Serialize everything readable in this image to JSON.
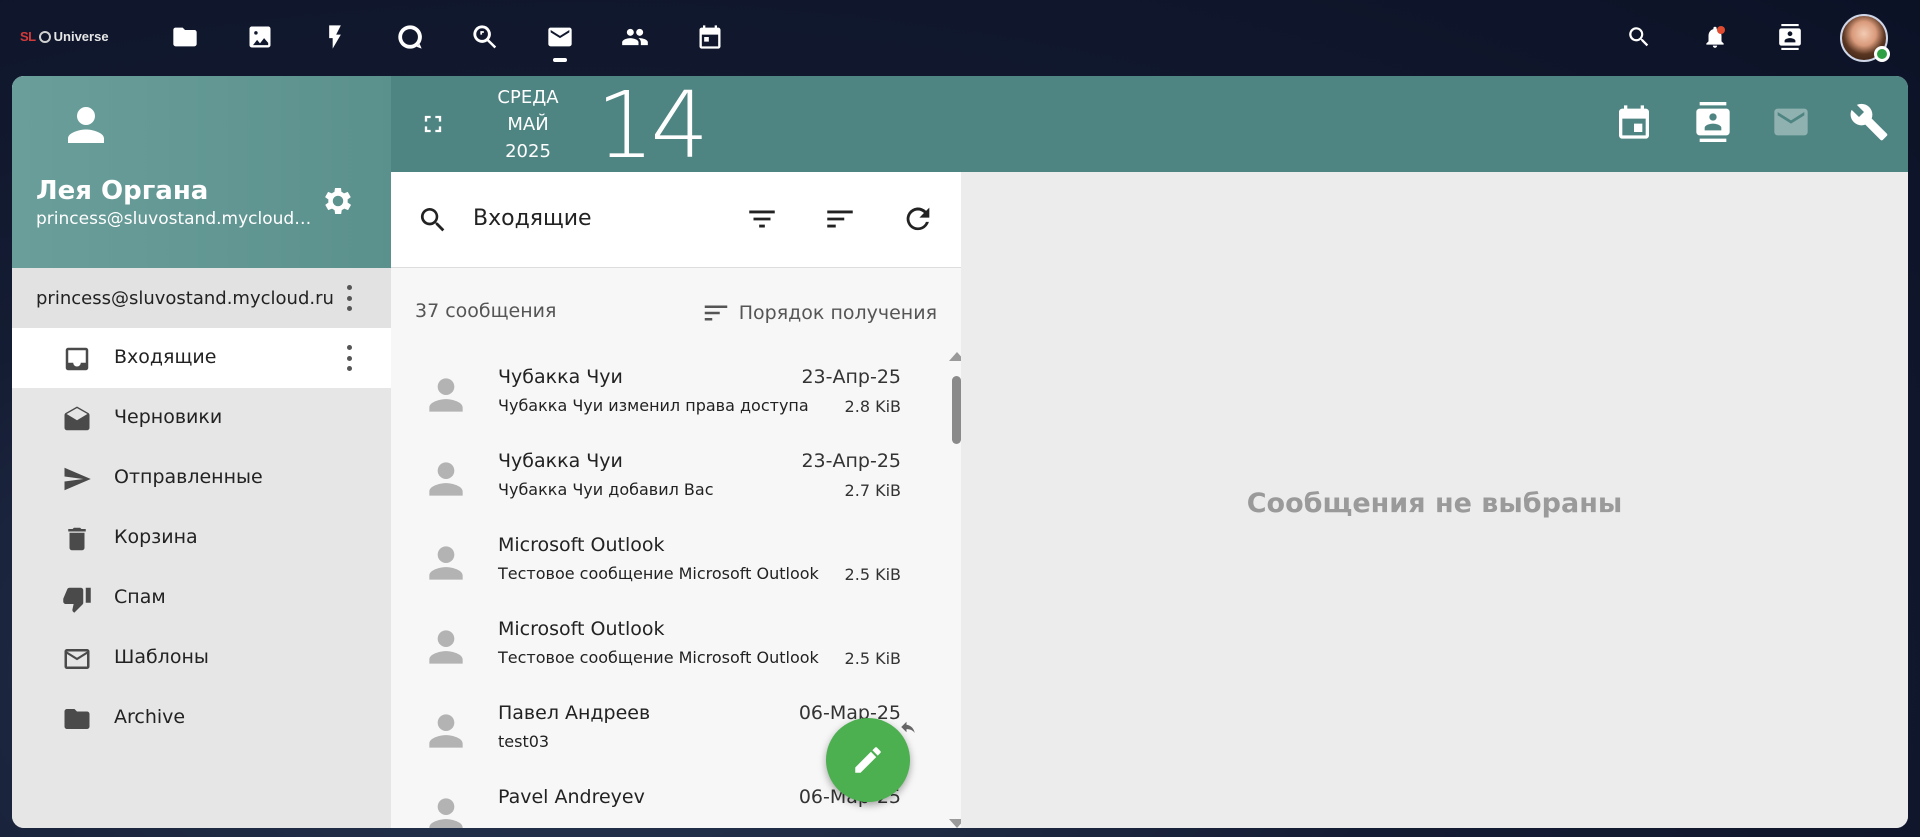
{
  "topbar": {
    "logo": {
      "prefix": "SL",
      "name": "Universe"
    },
    "nav_icons": [
      "folder-icon",
      "image-icon",
      "bolt-icon",
      "chat-icon",
      "search-key-icon",
      "mail-icon",
      "contacts-icon",
      "calendar-icon"
    ],
    "active_nav": "mail-icon",
    "right_icons": [
      "search-icon",
      "bell-icon",
      "contacts-card-icon"
    ],
    "notification_dot_color": "#e04b2f",
    "user_status_color": "#2ea043"
  },
  "sidebar": {
    "profile": {
      "name": "Лея Органа",
      "email": "princess@sluvostand.mycloud.ru"
    },
    "account": {
      "label": "princess@sluvostand.mycloud.ru"
    },
    "folders": [
      {
        "label": "Входящие",
        "icon": "inbox-icon",
        "active": true
      },
      {
        "label": "Черновики",
        "icon": "drafts-icon",
        "active": false
      },
      {
        "label": "Отправленные",
        "icon": "send-icon",
        "active": false
      },
      {
        "label": "Корзина",
        "icon": "trash-icon",
        "active": false
      },
      {
        "label": "Спам",
        "icon": "thumb-down-icon",
        "active": false
      },
      {
        "label": "Шаблоны",
        "icon": "envelope-icon",
        "active": false
      },
      {
        "label": "Archive",
        "icon": "folder-icon",
        "active": false
      }
    ]
  },
  "header": {
    "weekday": "СРЕДА",
    "month": "МАЙ",
    "year": "2025",
    "day": "14",
    "brand_color": "#4e8482"
  },
  "list": {
    "search_label": "Входящие",
    "count": "37 сообщения",
    "order_label": "Порядок получения",
    "messages": [
      {
        "sender": "Чубакка Чуи",
        "date": "23-Апр-25",
        "subject": "Чубакка Чуи изменил права доступа",
        "size": "2.8 KiB"
      },
      {
        "sender": "Чубакка Чуи",
        "date": "23-Апр-25",
        "subject": "Чубакка Чуи добавил Вас",
        "size": "2.7 KiB"
      },
      {
        "sender": "Microsoft Outlook",
        "date": "",
        "subject": "Тестовое сообщение Microsoft Outlook",
        "size": "2.5 KiB"
      },
      {
        "sender": "Microsoft Outlook",
        "date": "",
        "subject": "Тестовое сообщение Microsoft Outlook",
        "size": "2.5 KiB"
      },
      {
        "sender": "Павел Андреев",
        "date": "06-Мар-25",
        "subject": "test03",
        "size": ""
      },
      {
        "sender": "Pavel Andreyev",
        "date": "06-Мар-25",
        "subject": "",
        "size": ""
      }
    ]
  },
  "reader": {
    "empty_text": "Сообщения не выбраны"
  },
  "fab": {
    "icon": "pencil-icon",
    "color": "#4caf50"
  }
}
